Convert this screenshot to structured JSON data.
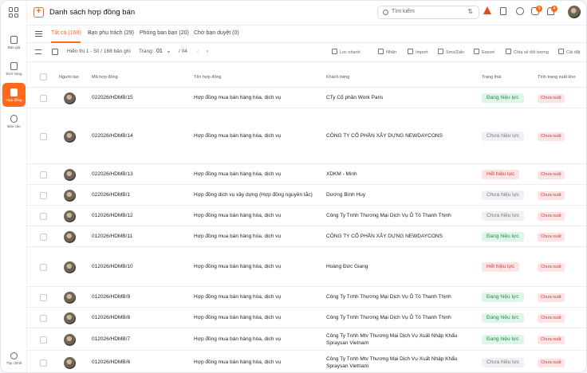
{
  "sidebar": {
    "items": [
      {
        "label": "Báo giá",
        "icon": "quote-icon"
      },
      {
        "label": "Đơn hàng",
        "icon": "order-icon"
      },
      {
        "label": "Hợp đồng",
        "icon": "contract-icon",
        "active": true
      },
      {
        "label": "Báo cáo",
        "icon": "report-icon"
      }
    ],
    "customize_label": "Tùy chỉnh"
  },
  "header": {
    "title": "Danh sách hợp đồng bán",
    "search_placeholder": "Tìm kiếm",
    "chat_badge": "9",
    "bell_badge": "4",
    "accent": "#ff6a1a"
  },
  "tabs": [
    {
      "label": "Tất cả (168)",
      "active": true
    },
    {
      "label": "Bạn phụ trách (29)"
    },
    {
      "label": "Phòng ban bạn (20)"
    },
    {
      "label": "Chờ bạn duyệt (0)"
    }
  ],
  "toolbar": {
    "showing": "Hiển thị 1 - 50 / 168 bản ghi",
    "page_label": "Trang:",
    "page_current": "01",
    "page_total": "/ 04",
    "actions": [
      "Lọc nhanh",
      "Nhãn",
      "Import",
      "Sms/Zalo",
      "Export",
      "Chia sẻ đối tượng",
      "Cài đặt"
    ]
  },
  "table": {
    "columns": [
      "Người tạo",
      "Mã hợp đồng",
      "Tên hợp đồng",
      "Khách hàng",
      "Trạng thái",
      "Tình trạng xuất kho"
    ],
    "rows": [
      {
        "code": "022026/HDMB/15",
        "name": "Hợp đồng mua bán hàng hóa, dịch vụ",
        "customer": "CTy Cổ phần Work Paris",
        "status": "Đang hiệu lực",
        "status_type": "active",
        "stock": "Chưa xuất"
      },
      {
        "code": "022026/HDMB/14",
        "name": "Hợp đồng mua bán hàng hóa, dịch vụ",
        "customer": "CÔNG TY CỔ PHẦN XÂY DỰNG NEWDAYCONS",
        "status": "Chưa hiệu lực",
        "status_type": "pending",
        "stock": "Chưa xuất"
      },
      {
        "code": "022026/HDMB/13",
        "name": "Hợp đồng mua bán hàng hóa, dịch vụ",
        "customer": "XDKM - Minh",
        "status": "Hết hiệu lực",
        "status_type": "expired",
        "stock": "Chưa xuất"
      },
      {
        "code": "022026/HDMB/1",
        "name": "Hợp đồng dịch vụ xây dựng (Hợp đồng nguyên tắc)",
        "customer": "Dương Bình Huy",
        "status": "Chưa hiệu lực",
        "status_type": "pending",
        "stock": "Chưa xuất"
      },
      {
        "code": "012026/HDMB/12",
        "name": "Hợp đồng mua bán hàng hóa, dịch vụ",
        "customer": "Công Ty Tnhh Thương Mại Dịch Vụ Ô Tô Thanh Thịnh",
        "status": "Chưa hiệu lực",
        "status_type": "pending",
        "stock": "Chưa xuất"
      },
      {
        "code": "012026/HDMB/11",
        "name": "Hợp đồng mua bán hàng hóa, dịch vụ",
        "customer": "CÔNG TY CỔ PHẦN XÂY DỰNG NEWDAYCONS",
        "status": "Đang hiệu lực",
        "status_type": "active",
        "stock": "Chưa xuất"
      },
      {
        "code": "012026/HDMB/10",
        "name": "Hợp đồng mua bán hàng hóa, dịch vụ",
        "customer": "Hoàng Đức Giang",
        "status": "Hết hiệu lực",
        "status_type": "expired",
        "stock": "Chưa xuất"
      },
      {
        "code": "012026/HDMB/9",
        "name": "Hợp đồng mua bán hàng hóa, dịch vụ",
        "customer": "Công Ty Tnhh Thương Mại Dịch Vụ Ô Tô Thanh Thịnh",
        "status": "Đang hiệu lực",
        "status_type": "active",
        "stock": "Chưa xuất"
      },
      {
        "code": "012026/HDMB/8",
        "name": "Hợp đồng mua bán hàng hóa, dịch vụ",
        "customer": "Công Ty Tnhh Thương Mại Dịch Vụ Ô Tô Thanh Thịnh",
        "status": "Đang hiệu lực",
        "status_type": "active",
        "stock": "Chưa xuất"
      },
      {
        "code": "012026/HDMB/7",
        "name": "Hợp đồng mua bán hàng hóa, dịch vụ",
        "customer": "Công Ty Tnhh Mtv Thương Mại Dịch Vụ Xuất Nhập Khẩu Spraysan Vietnam",
        "status": "Đang hiệu lực",
        "status_type": "active",
        "stock": "Chưa xuất"
      },
      {
        "code": "012026/HDMB/6",
        "name": "Hợp đồng mua bán hàng hóa, dịch vụ",
        "customer": "Công Ty Tnhh Mtv Thương Mại Dịch Vụ Xuất Nhập Khẩu Spraysan Vietnam",
        "status": "Chưa hiệu lực",
        "status_type": "pending",
        "stock": "Chưa xuất"
      }
    ]
  }
}
